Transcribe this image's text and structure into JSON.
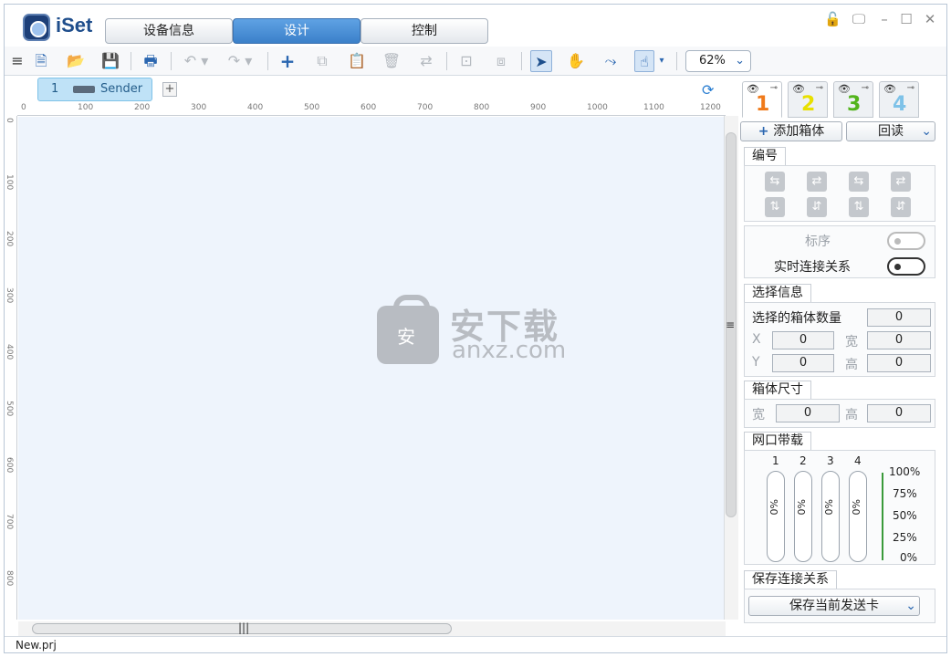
{
  "app": {
    "name": "iSet"
  },
  "main_tabs": [
    {
      "label": "设备信息"
    },
    {
      "label": "设计"
    },
    {
      "label": "控制"
    }
  ],
  "window_controls": [
    "lock-icon",
    "monitor-icon",
    "minimize-icon",
    "maximize-icon",
    "close-icon"
  ],
  "toolbar": {
    "zoom": "62%"
  },
  "canvas": {
    "sender_tab": {
      "index": "1",
      "name": "Sender 1"
    },
    "add_tab": "+",
    "ruler_top": [
      "0",
      "100",
      "200",
      "300",
      "400",
      "500",
      "600",
      "700",
      "800",
      "900",
      "1000",
      "1100",
      "1200"
    ],
    "ruler_left": [
      "0",
      "100",
      "200",
      "300",
      "400",
      "500",
      "600",
      "700",
      "800"
    ],
    "watermark": {
      "title": "安下载",
      "domain": "anxz.com",
      "badge": "安"
    }
  },
  "status": {
    "file": "New.prj"
  },
  "panel": {
    "tabs": [
      {
        "num": "1",
        "color": "#f07a1a"
      },
      {
        "num": "2",
        "color": "#e8e000"
      },
      {
        "num": "3",
        "color": "#53b41c"
      },
      {
        "num": "4",
        "color": "#7ec2e8"
      }
    ],
    "add_box": "添加箱体",
    "readback": "回读",
    "numbering": {
      "title": "编号"
    },
    "label_order": "标序",
    "live_connection": "实时连接关系",
    "selection": {
      "title": "选择信息",
      "count_label": "选择的箱体数量",
      "count": "0",
      "x_label": "X",
      "x": "0",
      "w_label": "宽",
      "w": "0",
      "y_label": "Y",
      "y": "0",
      "h_label": "高",
      "h": "0"
    },
    "box_size": {
      "title": "箱体尺寸",
      "w_label": "宽",
      "w": "0",
      "h_label": "高",
      "h": "0"
    },
    "bandwidth": {
      "title": "网口带载",
      "ports": [
        "1",
        "2",
        "3",
        "4"
      ],
      "values": [
        "0%",
        "0%",
        "0%",
        "0%"
      ],
      "scale": [
        "100%",
        "75%",
        "50%",
        "25%",
        "0%"
      ]
    },
    "save_conn": {
      "title": "保存连接关系",
      "button": "保存当前发送卡"
    }
  }
}
